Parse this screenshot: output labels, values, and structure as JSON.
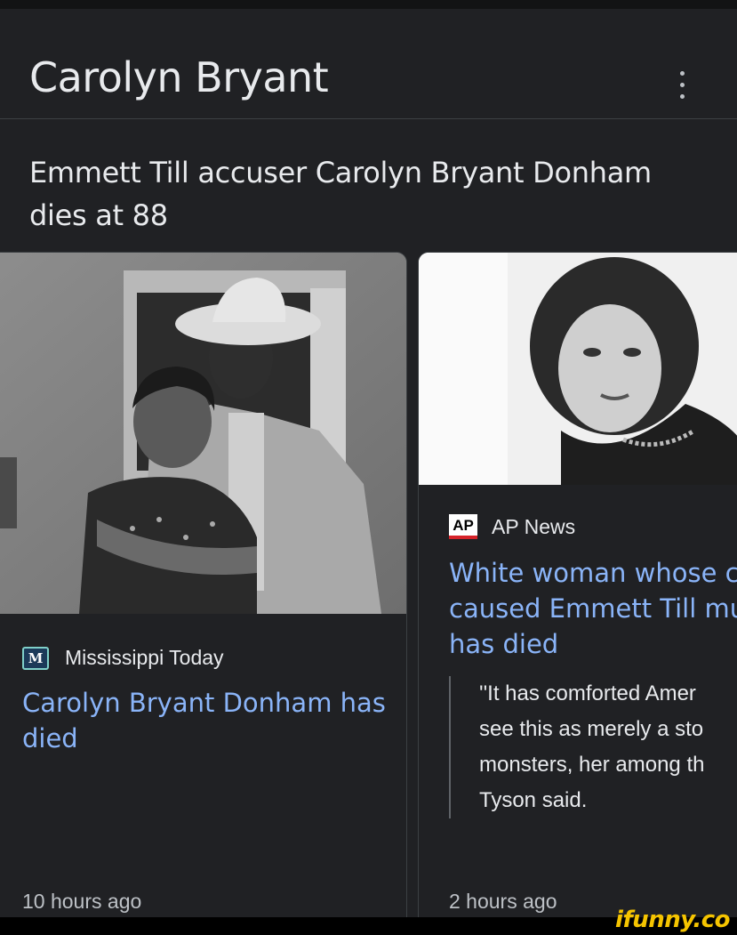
{
  "header": {
    "title": "Carolyn Bryant",
    "more_icon": "more-vert-icon"
  },
  "headline": "Emmett Till accuser Carolyn Bryant Donham dies at 88",
  "cards": [
    {
      "source": "Mississippi Today",
      "logo_text": "M",
      "title": "Carolyn Bryant Donham has died",
      "time": "10 hours ago"
    },
    {
      "source": "AP News",
      "logo_text": "AP",
      "title_lines": [
        "White woman whose c",
        "caused Emmett Till mu",
        "has died"
      ],
      "quote_lines": [
        "''It has comforted Amer",
        "see this as merely a sto",
        "monsters, her among th",
        "Tyson said."
      ],
      "time": "2 hours ago"
    }
  ],
  "watermark": "ifunny.co",
  "colors": {
    "background": "#202124",
    "link": "#8ab4f8",
    "text": "#e8eaed",
    "watermark": "#f5c400"
  }
}
